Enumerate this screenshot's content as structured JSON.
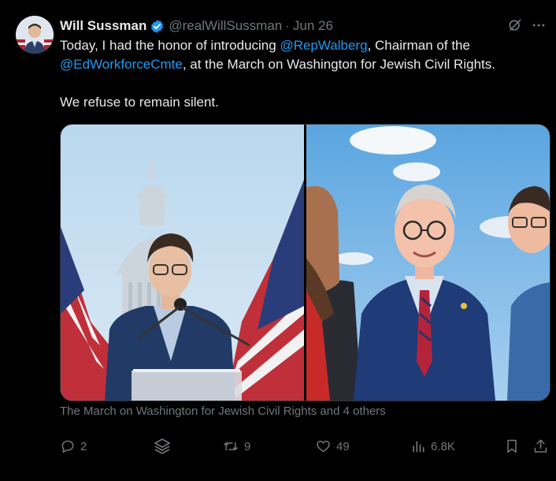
{
  "tweet": {
    "author_name": "Will Sussman",
    "handle": "@realWillSussman",
    "separator": "·",
    "date": "Jun 26",
    "verified": true,
    "text": {
      "line1_part1": "Today, I had the honor of introducing ",
      "mention1": "@RepWalberg",
      "line1_part2": ", Chairman of the ",
      "mention2": "@EdWorkforceCmte",
      "line2_part2": ", at the March on Washington for Jewish Civil Rights.",
      "paragraph2": "We refuse to remain silent."
    },
    "media_caption": "The March on Washington for Jewish Civil Rights and 4 others",
    "actions": {
      "replies": "2",
      "retweets": "9",
      "likes": "49",
      "views": "6.8K"
    }
  },
  "icons": {
    "verified": "verified-badge-icon",
    "grok": "grok-icon",
    "more": "more-icon",
    "reply": "reply-icon",
    "layers": "layers-icon",
    "retweet": "retweet-icon",
    "like": "heart-icon",
    "views": "views-icon",
    "bookmark": "bookmark-icon",
    "share": "share-icon"
  },
  "colors": {
    "background": "#000000",
    "text": "#e7e9ea",
    "muted": "#71767b",
    "link": "#1d9bf0"
  }
}
